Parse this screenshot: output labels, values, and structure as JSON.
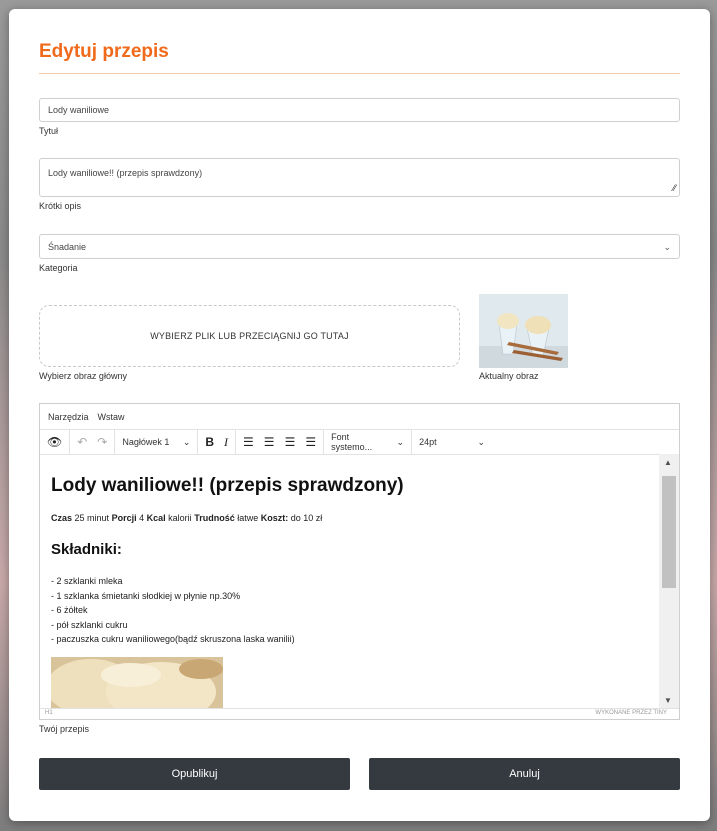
{
  "page": {
    "title": "Edytuj przepis"
  },
  "fields": {
    "title_value": "Lody waniliowe",
    "title_label": "Tytuł",
    "desc_value": "Lody waniliowe!! (przepis sprawdzony)",
    "desc_label": "Krótki opis",
    "category_value": "Śnadanie",
    "category_label": "Kategoria",
    "drop_text": "WYBIERZ PLIK LUB PRZECIĄGNIJ GO TUTAJ",
    "drop_label": "Wybierz obraz główny",
    "current_image_label": "Aktualny obraz"
  },
  "editor": {
    "menu": [
      "Narzędzia",
      "Wstaw"
    ],
    "block_format": "Nagłówek 1",
    "font_family": "Font systemo...",
    "font_size": "24pt",
    "heading": "Lody waniliowe!! (przepis sprawdzony)",
    "meta": {
      "czas_label": "Czas",
      "czas_value": "25 minut",
      "porcji_label": "Porcji",
      "porcji_value": "4",
      "kcal_label": "Kcal",
      "kcal_value": "kalorii",
      "trudnosc_label": "Trudność",
      "trudnosc_value": "łatwe",
      "koszt_label": "Koszt:",
      "koszt_value": "do 10 zł"
    },
    "subheading": "Składniki:",
    "ingredients": [
      "- 2 szklanki mleka",
      "- 1 szklanka śmietanki słodkiej w płynie np.30%",
      "- 6 żółtek",
      "- pół szklanki cukru",
      "- paczuszka cukru waniliowego(bądź skruszona laska wanilii)"
    ],
    "status_left": "H1",
    "status_right": "WYKONANE PRZEZ TINY",
    "label": "Twój przepis"
  },
  "buttons": {
    "publish": "Opublikuj",
    "cancel": "Anuluj"
  },
  "colors": {
    "accent": "#f06a1c",
    "button_bg": "#343a40"
  }
}
